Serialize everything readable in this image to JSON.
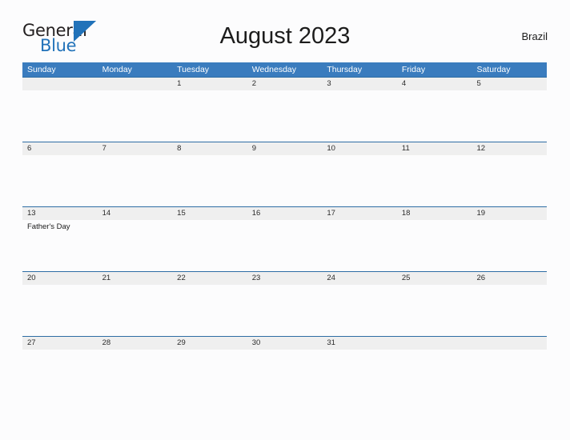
{
  "logo": {
    "text_top": "General",
    "text_bottom": "Blue",
    "triangle_icon": "triangle-icon",
    "color_primary": "#2172b9",
    "color_text": "#231f20"
  },
  "header": {
    "title": "August 2023",
    "country": "Brazil"
  },
  "theme": {
    "header_blue": "#3a7cbe",
    "row_divider_blue": "#2e6da4",
    "daynum_band_gray": "#efefef",
    "page_background": "#fcfcfd"
  },
  "calendar": {
    "weekdays": [
      "Sunday",
      "Monday",
      "Tuesday",
      "Wednesday",
      "Thursday",
      "Friday",
      "Saturday"
    ],
    "weeks": [
      {
        "days": [
          {
            "num": "",
            "event": ""
          },
          {
            "num": "",
            "event": ""
          },
          {
            "num": "1",
            "event": ""
          },
          {
            "num": "2",
            "event": ""
          },
          {
            "num": "3",
            "event": ""
          },
          {
            "num": "4",
            "event": ""
          },
          {
            "num": "5",
            "event": ""
          }
        ]
      },
      {
        "days": [
          {
            "num": "6",
            "event": ""
          },
          {
            "num": "7",
            "event": ""
          },
          {
            "num": "8",
            "event": ""
          },
          {
            "num": "9",
            "event": ""
          },
          {
            "num": "10",
            "event": ""
          },
          {
            "num": "11",
            "event": ""
          },
          {
            "num": "12",
            "event": ""
          }
        ]
      },
      {
        "days": [
          {
            "num": "13",
            "event": "Father's Day"
          },
          {
            "num": "14",
            "event": ""
          },
          {
            "num": "15",
            "event": ""
          },
          {
            "num": "16",
            "event": ""
          },
          {
            "num": "17",
            "event": ""
          },
          {
            "num": "18",
            "event": ""
          },
          {
            "num": "19",
            "event": ""
          }
        ]
      },
      {
        "days": [
          {
            "num": "20",
            "event": ""
          },
          {
            "num": "21",
            "event": ""
          },
          {
            "num": "22",
            "event": ""
          },
          {
            "num": "23",
            "event": ""
          },
          {
            "num": "24",
            "event": ""
          },
          {
            "num": "25",
            "event": ""
          },
          {
            "num": "26",
            "event": ""
          }
        ]
      },
      {
        "days": [
          {
            "num": "27",
            "event": ""
          },
          {
            "num": "28",
            "event": ""
          },
          {
            "num": "29",
            "event": ""
          },
          {
            "num": "30",
            "event": ""
          },
          {
            "num": "31",
            "event": ""
          },
          {
            "num": "",
            "event": ""
          },
          {
            "num": "",
            "event": ""
          }
        ]
      }
    ]
  }
}
